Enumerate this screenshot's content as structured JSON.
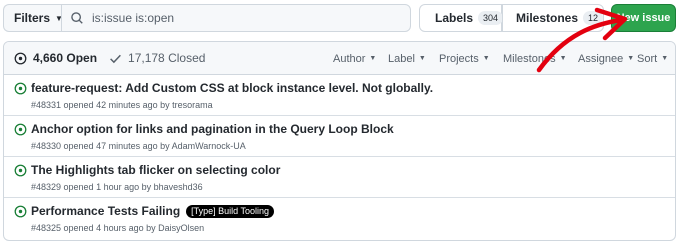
{
  "toolbar": {
    "filters_label": "Filters",
    "search_value": "is:issue is:open",
    "labels_label": "Labels",
    "labels_count": "304",
    "milestones_label": "Milestones",
    "milestones_count": "12",
    "new_issue_label": "New issue"
  },
  "header": {
    "open_label": "4,660 Open",
    "closed_label": "17,178 Closed",
    "filters": [
      "Author",
      "Label",
      "Projects",
      "Milestones",
      "Assignee",
      "Sort"
    ]
  },
  "issues": [
    {
      "title": "feature-request: Add Custom CSS at block instance level. Not globally.",
      "meta": "#48331 opened 42 minutes ago by tresorama",
      "label": ""
    },
    {
      "title": "Anchor option for links and pagination in the Query Loop Block",
      "meta": "#48330 opened 47 minutes ago by AdamWarnock-UA",
      "label": ""
    },
    {
      "title": "The Highlights tab flicker on selecting color",
      "meta": "#48329 opened 1 hour ago by bhaveshd36",
      "label": ""
    },
    {
      "title": "Performance Tests Failing",
      "meta": "#48325 opened 4 hours ago by DaisyOlsen",
      "label": "[Type] Build Tooling"
    }
  ],
  "colors": {
    "primary_button": "#2da44e",
    "open_icon": "#1a7f37",
    "annotation_arrow": "#e3000f",
    "label_bg": "#000000"
  }
}
